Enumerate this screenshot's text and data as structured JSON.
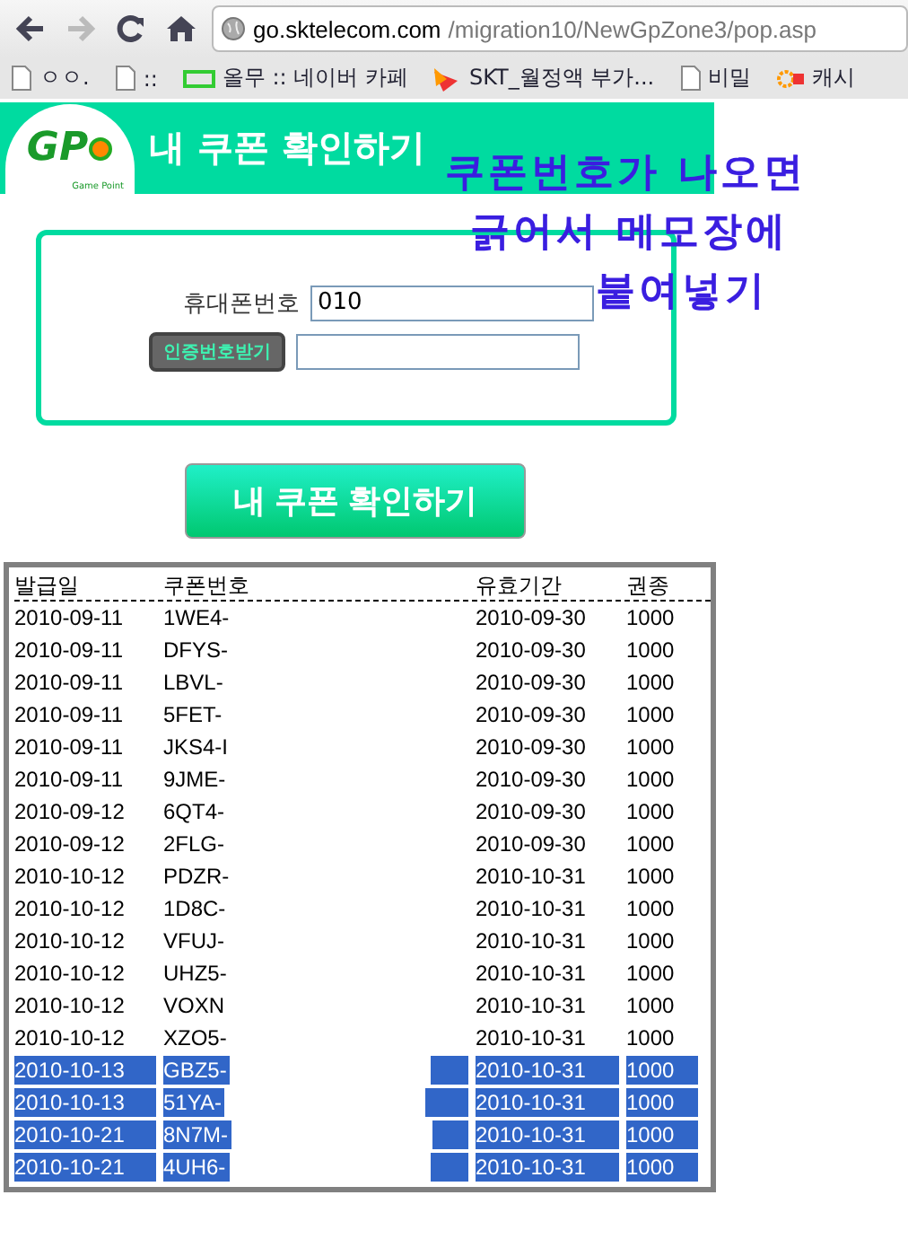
{
  "browser": {
    "nav": [
      {
        "kind": "back",
        "disabled": false
      },
      {
        "kind": "forward",
        "disabled": true
      },
      {
        "kind": "reload",
        "disabled": false
      },
      {
        "kind": "home",
        "disabled": false
      }
    ],
    "url": {
      "host": "go.sktelecom.com",
      "path": "/migration10/NewGpZone3/pop.asp"
    },
    "bookmarks": [
      {
        "kind": "page",
        "label": "ㅇㅇ."
      },
      {
        "kind": "page",
        "label": "::"
      },
      {
        "kind": "cafe",
        "label": "올무 :: 네이버 카페"
      },
      {
        "kind": "skt",
        "label": "SKT_월정액 부가..."
      },
      {
        "kind": "page",
        "label": "비밀"
      },
      {
        "kind": "ok",
        "label": "캐시"
      }
    ]
  },
  "header": {
    "logo": "GP",
    "logo_sub": "Game Point",
    "title": "내 쿠폰 확인하기"
  },
  "annotation": [
    "쿠폰번호가 나오면",
    "긁어서 메모장에",
    "붙여넣기"
  ],
  "form": {
    "phone_label": "휴대폰번호",
    "phone_value": "010",
    "auth_button": "인증번호받기"
  },
  "submit": "내 쿠폰 확인하기",
  "table": {
    "columns": [
      "발급일",
      "쿠폰번호",
      "유효기간",
      "권종"
    ],
    "rows": [
      {
        "cells": [
          "2010-09-11",
          "1WE4-",
          "2010-09-30",
          "1000"
        ],
        "selected": false
      },
      {
        "cells": [
          "2010-09-11",
          "DFYS-",
          "2010-09-30",
          "1000"
        ],
        "selected": false
      },
      {
        "cells": [
          "2010-09-11",
          "LBVL-",
          "2010-09-30",
          "1000"
        ],
        "selected": false
      },
      {
        "cells": [
          "2010-09-11",
          "5FET-",
          "2010-09-30",
          "1000"
        ],
        "selected": false
      },
      {
        "cells": [
          "2010-09-11",
          "JKS4-I",
          "2010-09-30",
          "1000"
        ],
        "selected": false
      },
      {
        "cells": [
          "2010-09-11",
          "9JME-",
          "2010-09-30",
          "1000"
        ],
        "selected": false
      },
      {
        "cells": [
          "2010-09-12",
          "6QT4-",
          "2010-09-30",
          "1000"
        ],
        "selected": false
      },
      {
        "cells": [
          "2010-09-12",
          "2FLG-",
          "2010-09-30",
          "1000"
        ],
        "selected": false
      },
      {
        "cells": [
          "2010-10-12",
          "PDZR-",
          "2010-10-31",
          "1000"
        ],
        "selected": false
      },
      {
        "cells": [
          "2010-10-12",
          "1D8C-",
          "2010-10-31",
          "1000"
        ],
        "selected": false
      },
      {
        "cells": [
          "2010-10-12",
          "VFUJ-",
          "2010-10-31",
          "1000"
        ],
        "selected": false
      },
      {
        "cells": [
          "2010-10-12",
          "UHZ5-",
          "2010-10-31",
          "1000"
        ],
        "selected": false
      },
      {
        "cells": [
          "2010-10-12",
          "VOXN",
          "2010-10-31",
          "1000"
        ],
        "selected": false
      },
      {
        "cells": [
          "2010-10-12",
          "XZO5-",
          "2010-10-31",
          "1000"
        ],
        "selected": false
      },
      {
        "cells": [
          "2010-10-13",
          "GBZ5-",
          "2010-10-31",
          "1000"
        ],
        "selected": true
      },
      {
        "cells": [
          "2010-10-13",
          "51YA-",
          "2010-10-31",
          "1000"
        ],
        "selected": true
      },
      {
        "cells": [
          "2010-10-21",
          "8N7M-",
          "2010-10-31",
          "1000"
        ],
        "selected": true
      },
      {
        "cells": [
          "2010-10-21",
          "4UH6-",
          "2010-10-31",
          "1000"
        ],
        "selected": true
      }
    ]
  }
}
